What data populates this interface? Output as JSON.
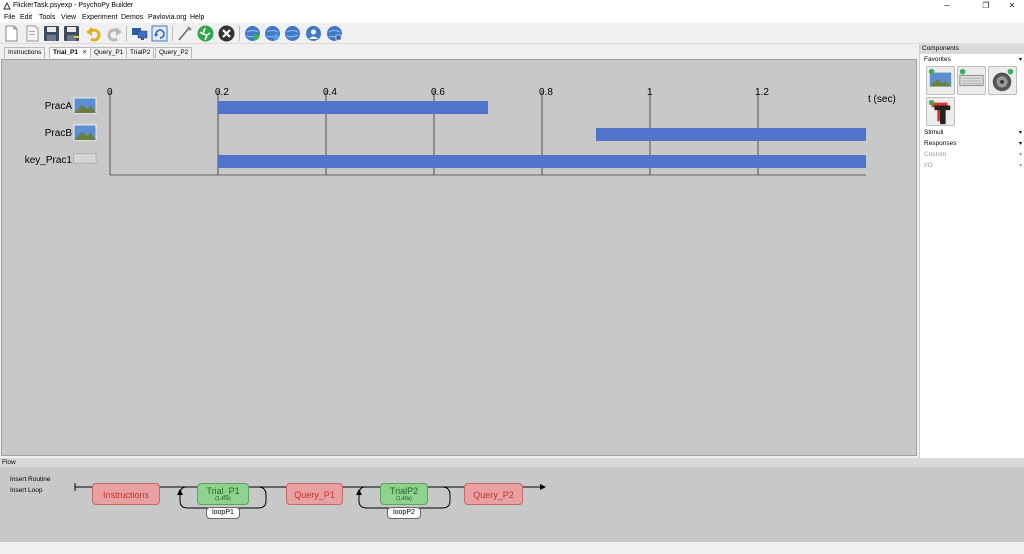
{
  "window": {
    "title": "FlickerTask.psyexp - PsychoPy Builder",
    "minimize": "─",
    "maximize": "❐",
    "close": "✕"
  },
  "menu": [
    "File",
    "Edit",
    "Tools",
    "View",
    "Experiment",
    "Demos",
    "Pavlovia.org",
    "Help"
  ],
  "toolbar": {
    "icons": [
      "new-file-icon",
      "open-file-icon",
      "save-icon",
      "save-as-icon",
      "undo-icon",
      "redo-icon",
      "monitor-center-icon",
      "experiment-settings-icon",
      "compile-script-icon",
      "run-icon",
      "stop-icon",
      "pavlovia-globe-icon",
      "pavlovia-sync-icon",
      "pavlovia-search-icon",
      "pavlovia-user-icon",
      "pavlovia-project-icon"
    ]
  },
  "tabs": [
    {
      "label": "Instructions",
      "active": false
    },
    {
      "label": "Trial_P1",
      "active": true,
      "close": "✕"
    },
    {
      "label": "Query_P1",
      "active": false
    },
    {
      "label": "TrialP2",
      "active": false
    },
    {
      "label": "Query_P2",
      "active": false
    }
  ],
  "timeline": {
    "unit_label": "t (sec)",
    "ticks": [
      "0",
      "0.2",
      "0.4",
      "0.6",
      "0.8",
      "1",
      "1.2"
    ],
    "max_time": 1.4,
    "bar_color": "#4f74c9",
    "components": [
      {
        "name": "PracA",
        "icon": "image-icon",
        "start": 0.2,
        "stop": 0.7
      },
      {
        "name": "PracB",
        "icon": "image-icon",
        "start": 0.9,
        "stop": 1.4
      },
      {
        "name": "key_Prac1",
        "icon": "keyboard-icon",
        "start": 0.2,
        "stop": 1.4
      }
    ]
  },
  "components_panel": {
    "header": "Components",
    "favorites": "Favorites",
    "categories": [
      {
        "label": "Stimuli",
        "enabled": true
      },
      {
        "label": "Responses",
        "enabled": true
      },
      {
        "label": "Custom",
        "enabled": false
      },
      {
        "label": "I/O",
        "enabled": false
      }
    ],
    "chevron": "▾",
    "favorite_icons": [
      "image-component-icon",
      "keyboard-component-icon",
      "sound-component-icon",
      "text-component-icon"
    ]
  },
  "flow": {
    "header": "Flow",
    "insert_routine": "Insert Routine",
    "insert_loop": "Insert Loop",
    "routines": [
      {
        "label": "Instructions",
        "color": "red"
      },
      {
        "label": "Trial_P1",
        "color": "green",
        "duration": "(1.40s)"
      },
      {
        "label": "Query_P1",
        "color": "red"
      },
      {
        "label": "TrialP2",
        "color": "green",
        "duration": "(1.40s)"
      },
      {
        "label": "Query_P2",
        "color": "red"
      }
    ],
    "loops": [
      "loopP1",
      "loopP2"
    ]
  }
}
